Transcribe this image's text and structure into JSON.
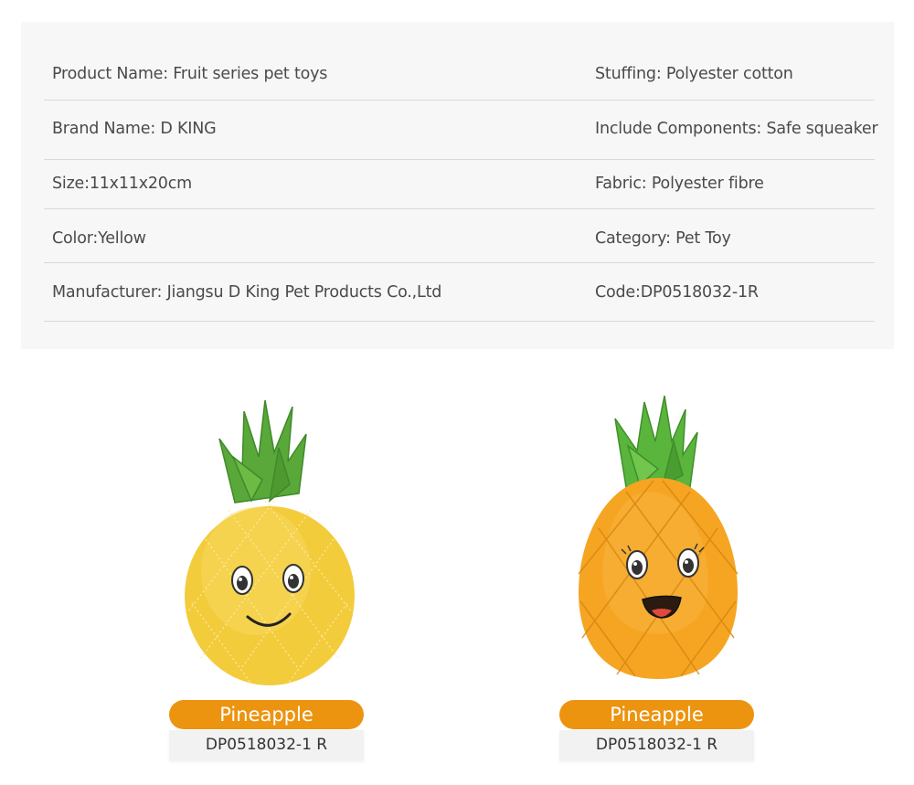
{
  "specs": {
    "rows": [
      {
        "left": "Product Name: Fruit series pet toys",
        "right": "Stuffing: Polyester cotton"
      },
      {
        "left": "Brand Name: D KING",
        "right": "Include Components: Safe squeaker"
      },
      {
        "left": "Size:11x11x20cm",
        "right": "Fabric: Polyester fibre"
      },
      {
        "left": "Color:Yellow",
        "right": "Category: Pet Toy"
      },
      {
        "left": "Manufacturer: Jiangsu D King Pet Products Co.,Ltd",
        "right": "Code:DP0518032-1R"
      }
    ]
  },
  "products": [
    {
      "name": "Pineapple",
      "code": "DP0518032-1 R"
    },
    {
      "name": "Pineapple",
      "code": "DP0518032-1 R"
    }
  ],
  "colors": {
    "panel_bg": "#f7f7f7",
    "pill_orange": "#ec9410",
    "yellow_toy": "#f3cc3c",
    "orange_toy": "#f5a522",
    "leaf_green": "#5aa83a"
  }
}
